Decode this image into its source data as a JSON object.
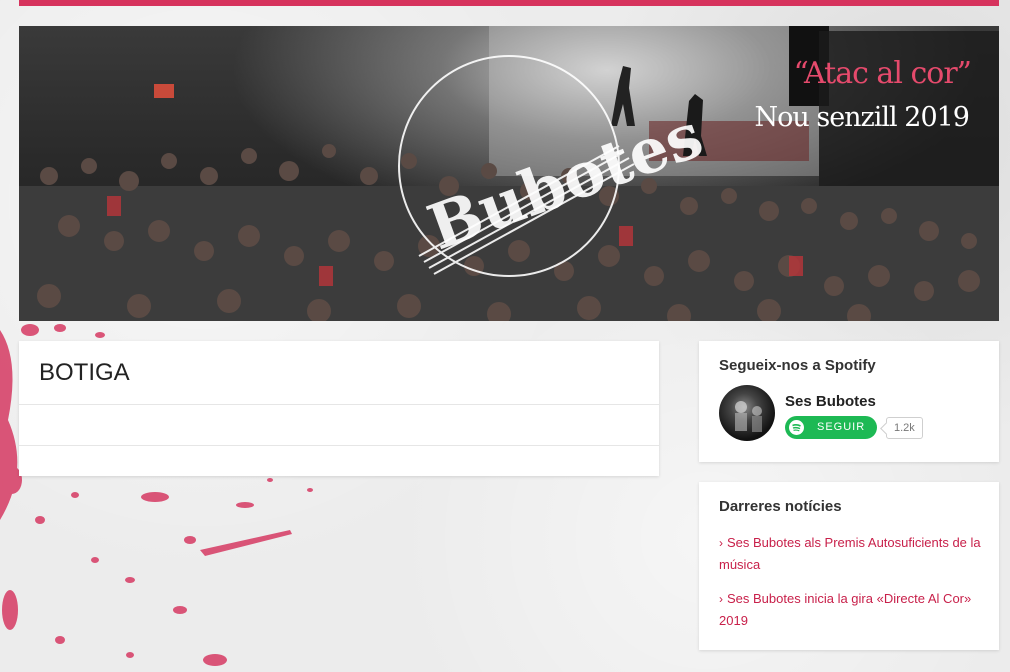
{
  "hero": {
    "quote": "“Atac al cor”",
    "subtitle": "Nou senzill 2019",
    "logo_text": "Bubotes"
  },
  "main": {
    "title": "BOTIGA"
  },
  "spotify_widget": {
    "title": "Segueix-nos a Spotify",
    "artist": "Ses Bubotes",
    "follow_label": "SEGUIR",
    "follower_count": "1.2k"
  },
  "news_widget": {
    "title": "Darreres notícies",
    "items": [
      {
        "label": "Ses Bubotes als Premis Autosuficients de la música"
      },
      {
        "label": "Ses Bubotes inicia la gira «Directe Al Cor» 2019"
      }
    ]
  },
  "colors": {
    "accent": "#d6335d",
    "link": "#c8204a",
    "spotify_green": "#1db954"
  }
}
